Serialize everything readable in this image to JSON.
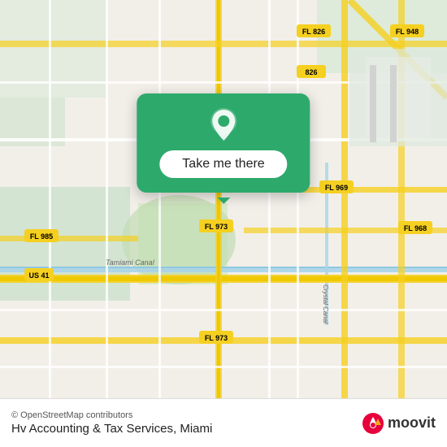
{
  "map": {
    "alt": "Map of Miami area"
  },
  "popup": {
    "button_label": "Take me there",
    "pin_icon": "location-pin"
  },
  "bottom_bar": {
    "copyright": "© OpenStreetMap contributors",
    "location": "Hv Accounting & Tax Services, Miami",
    "logo_text": "moovit"
  },
  "colors": {
    "popup_bg": "#2daa6b",
    "button_bg": "#ffffff",
    "moovit_red": "#e8003d",
    "moovit_orange": "#f5a623"
  }
}
